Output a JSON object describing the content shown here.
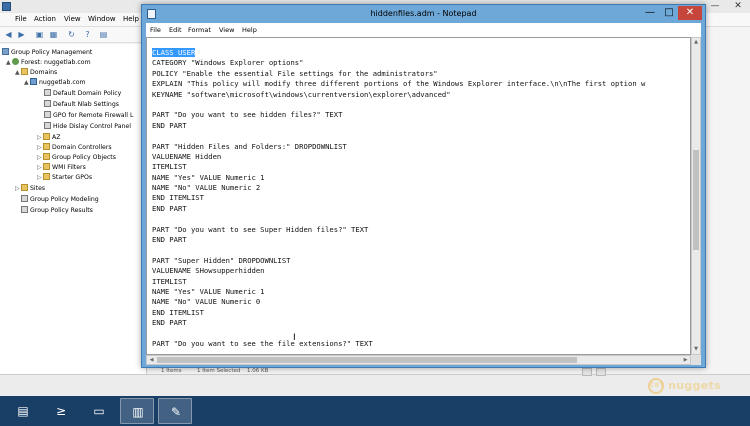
{
  "mmc": {
    "menu": [
      "File",
      "Action",
      "View",
      "Window",
      "Help"
    ],
    "tree": [
      {
        "label": "Group Policy Management",
        "icon": "gpm-icon",
        "expander": ""
      },
      {
        "label": "Forest: nuggetlab.com",
        "icon": "forest-icon",
        "expander": "▲"
      },
      {
        "label": "Domains",
        "icon": "folder-icon",
        "expander": "▲"
      },
      {
        "label": "nuggetlab.com",
        "icon": "domain-icon",
        "expander": "▲"
      },
      {
        "label": "Default Domain Policy",
        "icon": "gpo-icon",
        "expander": ""
      },
      {
        "label": "Default Nlab Settings",
        "icon": "gpo-icon",
        "expander": ""
      },
      {
        "label": "GPO for Remote Firewall L",
        "icon": "gpo-icon",
        "expander": ""
      },
      {
        "label": "Hide Dislay Control Panel",
        "icon": "gpo-icon",
        "expander": ""
      },
      {
        "label": "AZ",
        "icon": "folder-icon",
        "expander": "▷"
      },
      {
        "label": "Domain Controllers",
        "icon": "folder-icon",
        "expander": "▷"
      },
      {
        "label": "Group Policy Objects",
        "icon": "folder-icon",
        "expander": "▷"
      },
      {
        "label": "WMI Filters",
        "icon": "folder-icon",
        "expander": "▷"
      },
      {
        "label": "Starter GPOs",
        "icon": "folder-icon",
        "expander": "▷"
      },
      {
        "label": "Sites",
        "icon": "folder-icon",
        "expander": "▷"
      },
      {
        "label": "Group Policy Modeling",
        "icon": "gpo-icon",
        "expander": ""
      },
      {
        "label": "Group Policy Results",
        "icon": "gpo-icon",
        "expander": ""
      }
    ],
    "status_peek": [
      "1 Items",
      "1 Item Selected",
      "1.06 KB"
    ]
  },
  "notepad": {
    "title": "hiddenfiles.adm - Notepad",
    "menu": [
      "File",
      "Edit",
      "Format",
      "View",
      "Help"
    ],
    "min": "—",
    "max": "□",
    "close": "✕",
    "lines": [
      "CLASS USER",
      "CATEGORY \"Windows Explorer options\"",
      "POLICY \"Enable the essential File settings for the administrators\"",
      "EXPLAIN \"This policy will modify three different portions of the Windows Explorer interface.\\n\\nThe first option w",
      "KEYNAME \"software\\microsoft\\windows\\currentversion\\explorer\\advanced\"",
      "",
      "PART \"Do you want to see hidden files?\" TEXT",
      "END PART",
      "",
      "PART \"Hidden Files and Folders:\" DROPDOWNLIST",
      "VALUENAME Hidden",
      "ITEMLIST",
      "NAME \"Yes\" VALUE Numeric 1",
      "NAME \"No\" VALUE Numeric 2",
      "END ITEMLIST",
      "END PART",
      "",
      "PART \"Do you want to see Super Hidden files?\" TEXT",
      "END PART",
      "",
      "PART \"Super Hidden\" DROPDOWNLIST",
      "VALUENAME SHowsupperhidden",
      "ITEMLIST",
      "NAME \"Yes\" VALUE Numeric 1",
      "NAME \"No\" VALUE Numeric 0",
      "END ITEMLIST",
      "END PART",
      "",
      "PART \"Do you want to see the file extensions?\" TEXT"
    ],
    "selected_line_index": 0
  },
  "watermark": {
    "text": "nuggets",
    "badge": "CBT"
  },
  "taskbar": {
    "items": [
      {
        "name": "server-manager-icon",
        "glyph": "▤"
      },
      {
        "name": "powershell-icon",
        "glyph": "≥"
      },
      {
        "name": "file-explorer-icon",
        "glyph": "▭"
      },
      {
        "name": "group-policy-icon",
        "glyph": "▥"
      },
      {
        "name": "notepad-icon",
        "glyph": "✎"
      }
    ]
  },
  "colors": {
    "selection": "#3399ff",
    "taskbar": "#1a3f67",
    "title_accent": "#6ea8d8",
    "close": "#c7463b"
  }
}
